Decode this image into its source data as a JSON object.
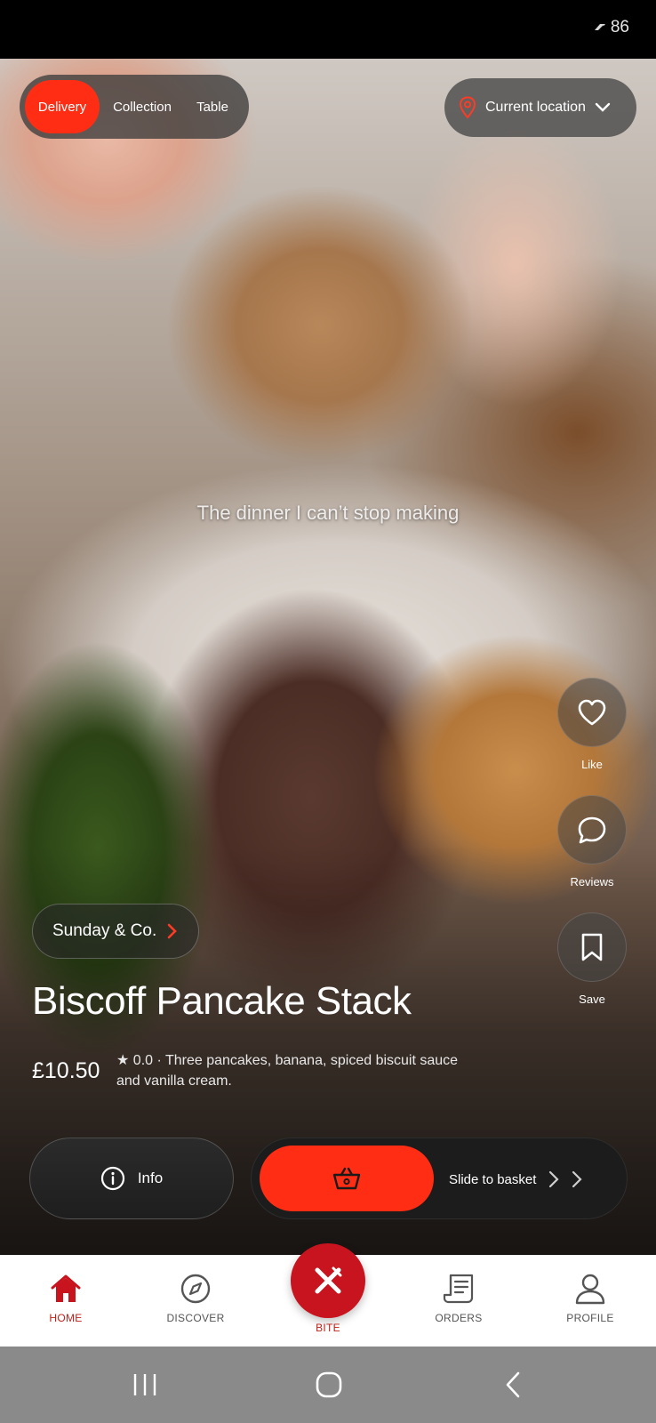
{
  "status_bar": {
    "battery": "86"
  },
  "order_type": {
    "options": [
      "Delivery",
      "Collection",
      "Table"
    ],
    "selected": "Delivery"
  },
  "location": {
    "label": "Current location"
  },
  "video": {
    "caption": "The dinner I can’t stop making"
  },
  "side_actions": {
    "like": "Like",
    "reviews": "Reviews",
    "save": "Save"
  },
  "restaurant": {
    "name": "Sunday & Co."
  },
  "dish": {
    "title": "Biscoff Pancake Stack",
    "price": "£10.50",
    "description": "★ 0.0 · Three pancakes, banana, spiced biscuit sauce and vanilla cream."
  },
  "actions": {
    "info": "Info",
    "slide": "Slide to basket"
  },
  "nav": {
    "home": "HOME",
    "discover": "DISCOVER",
    "bite": "BITE",
    "orders": "ORDERS",
    "profile": "PROFILE"
  },
  "colors": {
    "accent": "#ff2d14",
    "brand": "#c8141e",
    "nav_active": "#c0211a"
  },
  "icons": [
    "location-pin-icon",
    "chevron-down-icon",
    "heart-icon",
    "chat-bubble-icon",
    "bookmark-icon",
    "chevron-right-icon",
    "info-icon",
    "basket-icon",
    "home-icon",
    "compass-icon",
    "fork-knife-icon",
    "receipt-icon",
    "person-icon"
  ]
}
